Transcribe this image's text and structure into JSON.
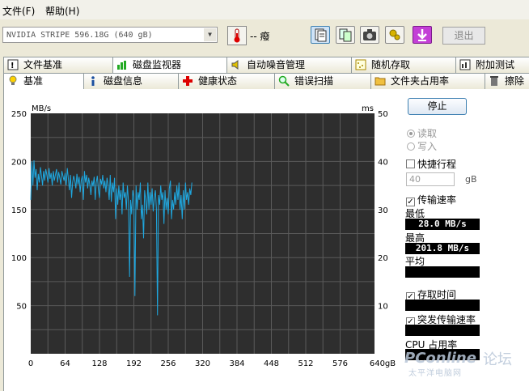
{
  "menu": {
    "file": "文件(F)",
    "help": "帮助(H)"
  },
  "toolbar": {
    "drive": "NVIDIA  STRIPE   596.18G (640 gB)",
    "temperature": "-- 癈",
    "exit": "退出"
  },
  "tabs_top": [
    "文件基准",
    "磁盘监视器",
    "自动噪音管理",
    "随机存取",
    "附加测试"
  ],
  "tabs_bottom": [
    "基准",
    "磁盘信息",
    "健康状态",
    "错误扫描",
    "文件夹占用率",
    "擦除"
  ],
  "chart_data": {
    "type": "line",
    "ylabel_left": "MB/s",
    "ylabel_right": "ms",
    "ylim": [
      0,
      250
    ],
    "y2lim": [
      0,
      50
    ],
    "xlim": [
      0,
      640
    ],
    "xunit": "gB",
    "yticks": [
      "250",
      "200",
      "150",
      "100",
      "50"
    ],
    "y2ticks": [
      "50",
      "40",
      "30",
      "20",
      "10"
    ],
    "xticks": [
      "0",
      "64",
      "128",
      "192",
      "256",
      "320",
      "384",
      "448",
      "512",
      "576",
      "640gB"
    ],
    "series": [
      {
        "color": "#1fa8e0",
        "x": [
          0,
          2,
          4,
          6,
          8,
          10,
          12,
          14,
          16,
          18,
          20,
          22,
          24,
          26,
          28,
          30,
          32,
          34,
          36,
          38,
          40,
          42,
          44,
          46,
          48,
          50,
          52,
          54,
          56,
          58,
          60,
          62,
          64,
          66,
          68,
          70,
          72,
          74,
          76,
          78,
          80,
          82,
          84,
          86,
          88,
          90,
          92,
          94,
          96,
          98,
          100,
          102,
          104,
          106,
          108,
          110,
          112,
          114,
          116,
          118,
          120,
          122,
          124,
          126,
          128,
          130,
          132,
          134,
          136,
          138,
          140,
          142,
          144,
          146,
          148,
          150,
          152,
          154,
          156,
          158,
          160,
          162,
          164,
          166,
          168,
          170,
          172,
          174,
          176,
          178,
          180,
          182,
          184,
          186,
          188,
          190,
          192,
          194,
          196,
          198,
          200,
          202,
          204,
          206,
          208,
          210,
          212,
          214,
          216,
          218,
          220,
          222,
          224,
          226,
          228,
          230,
          232,
          234,
          236,
          238,
          240,
          242,
          244,
          246,
          248,
          250,
          252,
          254,
          256,
          258,
          260,
          262,
          264,
          266,
          268,
          270,
          272,
          274,
          276,
          278,
          280,
          282,
          284,
          286,
          288,
          290,
          292,
          294,
          296,
          298,
          300
        ],
        "values": [
          160,
          200,
          175,
          201,
          183,
          192,
          170,
          187,
          178,
          194,
          185,
          175,
          190,
          180,
          192,
          186,
          178,
          193,
          182,
          188,
          175,
          190,
          180,
          186,
          192,
          178,
          189,
          183,
          176,
          190,
          185,
          180,
          188,
          175,
          193,
          182,
          170,
          186,
          162,
          178,
          185,
          180,
          172,
          187,
          176,
          184,
          168,
          180,
          185,
          160,
          190,
          178,
          186,
          172,
          183,
          176,
          165,
          180,
          174,
          184,
          160,
          178,
          185,
          170,
          162,
          182,
          176,
          186,
          172,
          180,
          168,
          183,
          175,
          160,
          186,
          158,
          178,
          168,
          183,
          140,
          172,
          155,
          175,
          160,
          170,
          145,
          178,
          162,
          168,
          150,
          175,
          158,
          80,
          160,
          145,
          170,
          163,
          60,
          175,
          150,
          168,
          160,
          178,
          140,
          155,
          120,
          170,
          160,
          145,
          178,
          150,
          168,
          155,
          172,
          148,
          162,
          170,
          150,
          40,
          165,
          155,
          175,
          160,
          168,
          135,
          170,
          150,
          162,
          145,
          172,
          180,
          140,
          160,
          150,
          168,
          155,
          175,
          160,
          178,
          150,
          165,
          140,
          170,
          150,
          178,
          160,
          168,
          155,
          172,
          165,
          178
        ]
      }
    ]
  },
  "side": {
    "stop": "停止",
    "read": "读取",
    "write": "写入",
    "quick": "快捷行程",
    "quick_value": "40",
    "quick_unit": "gB",
    "transfer": "传输速率",
    "min_label": "最低",
    "min_value": "28.0 MB/s",
    "max_label": "最高",
    "max_value": "201.8 MB/s",
    "avg_label": "平均",
    "access": "存取时间",
    "burst": "突发传输速率",
    "cpu": "CPU 占用率"
  },
  "watermark": {
    "brand": "PConline",
    "cn": "论坛",
    "sub": "太平洋电脑网"
  },
  "colors": {
    "plot_bg": "#2e2e2e",
    "grid": "#5a5a5a",
    "line": "#1fa8e0"
  }
}
